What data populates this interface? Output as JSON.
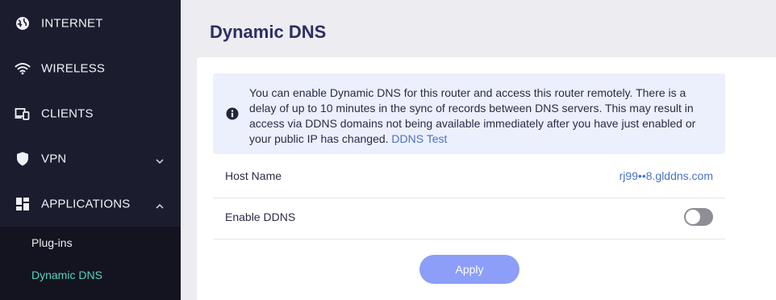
{
  "sidebar": {
    "items": [
      {
        "label": "INTERNET",
        "icon": "globe-icon"
      },
      {
        "label": "WIRELESS",
        "icon": "wifi-icon"
      },
      {
        "label": "CLIENTS",
        "icon": "devices-icon"
      },
      {
        "label": "VPN",
        "icon": "shield-icon",
        "chevron": "down"
      },
      {
        "label": "APPLICATIONS",
        "icon": "apps-grid-icon",
        "chevron": "up"
      }
    ],
    "submenu": [
      {
        "label": "Plug-ins",
        "active": false
      },
      {
        "label": "Dynamic DNS",
        "active": true
      }
    ]
  },
  "main": {
    "title": "Dynamic DNS",
    "info": {
      "text": "You can enable Dynamic DNS for this router and access this router remotely. There is a delay of up to 10 minutes in the sync of records between DNS servers. This may result in access via DDNS domains not being available immediately after you have just enabled or your public IP has changed.",
      "link": "DDNS Test"
    },
    "host_name": {
      "label": "Host Name",
      "value": "rj99••8.glddns.com"
    },
    "enable_ddns": {
      "label": "Enable DDNS",
      "enabled": false
    },
    "apply_label": "Apply"
  },
  "colors": {
    "sidebar_bg": "#1b1d2e",
    "submenu_bg": "#13141f",
    "active_accent": "#56d4c0",
    "link": "#4a72c7",
    "button": "#8c9ef7",
    "title": "#2d2e63"
  }
}
